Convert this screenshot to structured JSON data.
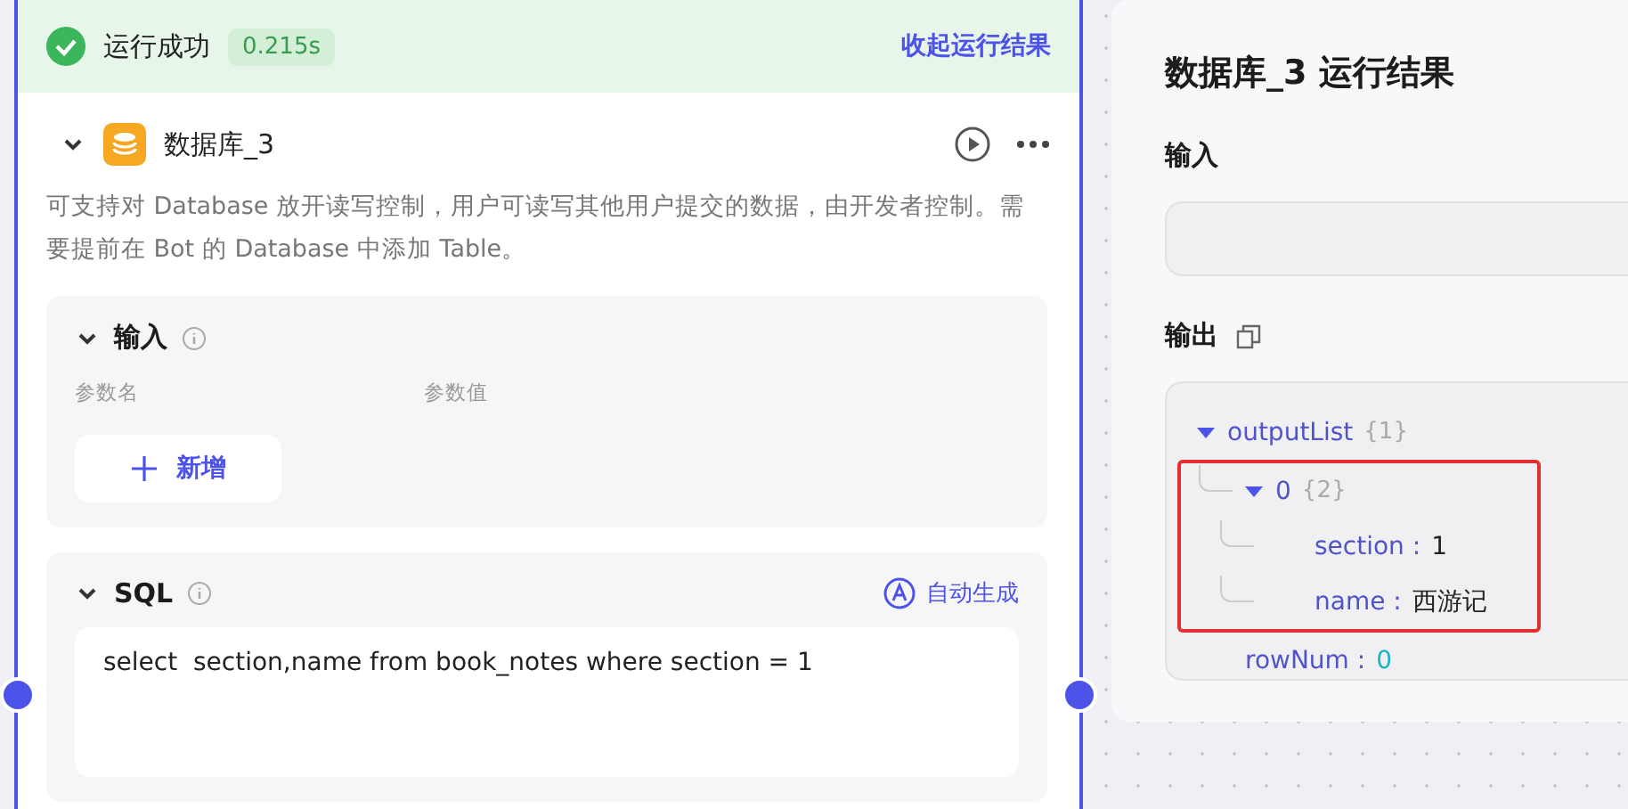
{
  "run_status": {
    "label": "运行成功",
    "duration": "0.215s",
    "collapse_link": "收起运行结果"
  },
  "node": {
    "title": "数据库_3",
    "expanded": true,
    "description": "可支持对 Database 放开读写控制，用户可读写其他用户提交的数据，由开发者控制。需要提前在 Bot 的 Database 中添加 Table。",
    "input_section": {
      "title": "输入",
      "expanded": true,
      "columns": [
        "参数名",
        "参数值"
      ],
      "add_button": "新增"
    },
    "sql_section": {
      "title": "SQL",
      "expanded": true,
      "auto_button": "自动生成",
      "query": "select  section,name from book_notes where section = 1"
    }
  },
  "result_panel": {
    "title": "数据库_3 运行结果",
    "input_label": "输入",
    "output_label": "输出",
    "tree": [
      {
        "key": "outputList",
        "count": "{1}",
        "expanded": true,
        "highlighted": false,
        "children": [
          {
            "key": "0",
            "count": "{2}",
            "expanded": true,
            "highlighted": true,
            "children": [
              {
                "key": "section",
                "separator": ":",
                "value": "1",
                "kind": "string"
              },
              {
                "key": "name",
                "separator": ":",
                "value": "西游记",
                "kind": "string"
              }
            ]
          }
        ]
      },
      {
        "key": "rowNum",
        "separator": ":",
        "value": "0",
        "kind": "number"
      }
    ]
  }
}
